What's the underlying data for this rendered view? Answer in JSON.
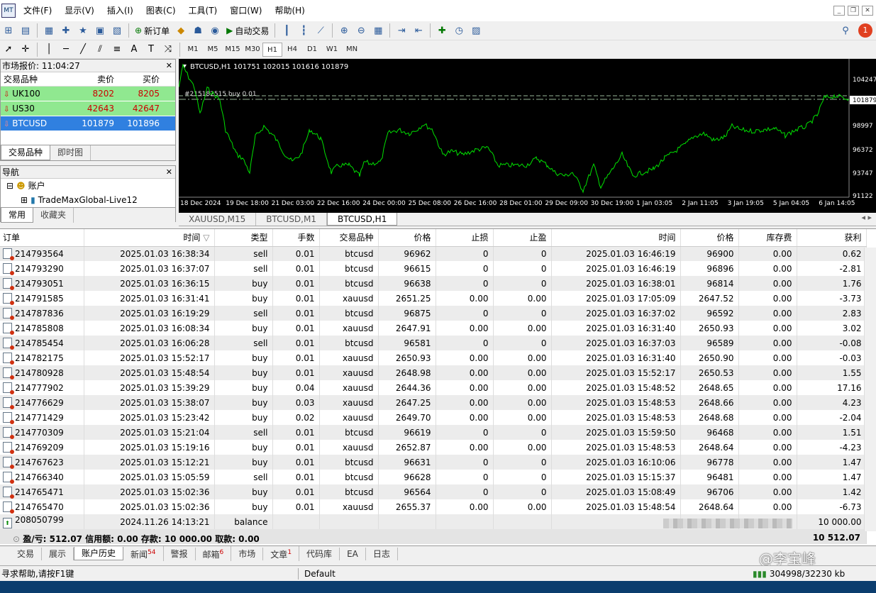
{
  "menu": {
    "items": [
      "文件(F)",
      "显示(V)",
      "插入(I)",
      "图表(C)",
      "工具(T)",
      "窗口(W)",
      "帮助(H)"
    ]
  },
  "toolbar": {
    "new_order": "新订单",
    "auto_trade": "自动交易",
    "timeframes": [
      "M1",
      "M5",
      "M15",
      "M30",
      "H1",
      "H4",
      "D1",
      "W1",
      "MN"
    ],
    "selected_tf": "H1",
    "alert_count": "1"
  },
  "market": {
    "title": "市场报价: 11:04:27",
    "col_symbol": "交易品种",
    "col_bid": "卖价",
    "col_ask": "买价",
    "rows": [
      {
        "symbol": "UK100",
        "bid": "8202",
        "ask": "8205"
      },
      {
        "symbol": "US30",
        "bid": "42643",
        "ask": "42647"
      },
      {
        "symbol": "BTCUSD",
        "bid": "101879",
        "ask": "101896"
      }
    ],
    "tabs": [
      "交易品种",
      "即时图"
    ]
  },
  "nav": {
    "title": "导航",
    "accounts": "账户",
    "account_name": "TradeMaxGlobal-Live12",
    "tabs": [
      "常用",
      "收藏夹"
    ]
  },
  "chart": {
    "header": "BTCUSD,H1  101751 102015 101616 101879",
    "order_label": "#215182515 buy 0.01",
    "price_labels": [
      "104247",
      "101879",
      "98997",
      "96372",
      "93747",
      "91122"
    ],
    "x_labels": [
      "18 Dec 2024",
      "19 Dec 18:00",
      "21 Dec 03:00",
      "22 Dec 16:00",
      "24 Dec 00:00",
      "25 Dec 08:00",
      "26 Dec 16:00",
      "28 Dec 01:00",
      "29 Dec 09:00",
      "30 Dec 19:00",
      "1 Jan 03:05",
      "2 Jan 11:05",
      "3 Jan 19:05",
      "5 Jan 04:05",
      "6 Jan 14:05"
    ],
    "colors": {
      "line": "#00e000",
      "bg": "#000000",
      "order_line": "#9ab89a"
    }
  },
  "chart_tabs": [
    "XAUUSD,M15",
    "BTCUSD,M1",
    "BTCUSD,H1"
  ],
  "history": {
    "headers": [
      "订单",
      "时间",
      "类型",
      "手数",
      "交易品种",
      "价格",
      "止损",
      "止盈",
      "时间",
      "价格",
      "库存费",
      "获利"
    ],
    "rows": [
      [
        "214793564",
        "2025.01.03 16:38:34",
        "sell",
        "0.01",
        "btcusd",
        "96962",
        "0",
        "0",
        "2025.01.03 16:46:19",
        "96900",
        "0.00",
        "0.62"
      ],
      [
        "214793290",
        "2025.01.03 16:37:07",
        "sell",
        "0.01",
        "btcusd",
        "96615",
        "0",
        "0",
        "2025.01.03 16:46:19",
        "96896",
        "0.00",
        "-2.81"
      ],
      [
        "214793051",
        "2025.01.03 16:36:15",
        "buy",
        "0.01",
        "btcusd",
        "96638",
        "0",
        "0",
        "2025.01.03 16:38:01",
        "96814",
        "0.00",
        "1.76"
      ],
      [
        "214791585",
        "2025.01.03 16:31:41",
        "buy",
        "0.01",
        "xauusd",
        "2651.25",
        "0.00",
        "0.00",
        "2025.01.03 17:05:09",
        "2647.52",
        "0.00",
        "-3.73"
      ],
      [
        "214787836",
        "2025.01.03 16:19:29",
        "sell",
        "0.01",
        "btcusd",
        "96875",
        "0",
        "0",
        "2025.01.03 16:37:02",
        "96592",
        "0.00",
        "2.83"
      ],
      [
        "214785808",
        "2025.01.03 16:08:34",
        "buy",
        "0.01",
        "xauusd",
        "2647.91",
        "0.00",
        "0.00",
        "2025.01.03 16:31:40",
        "2650.93",
        "0.00",
        "3.02"
      ],
      [
        "214785454",
        "2025.01.03 16:06:28",
        "sell",
        "0.01",
        "btcusd",
        "96581",
        "0",
        "0",
        "2025.01.03 16:37:03",
        "96589",
        "0.00",
        "-0.08"
      ],
      [
        "214782175",
        "2025.01.03 15:52:17",
        "buy",
        "0.01",
        "xauusd",
        "2650.93",
        "0.00",
        "0.00",
        "2025.01.03 16:31:40",
        "2650.90",
        "0.00",
        "-0.03"
      ],
      [
        "214780928",
        "2025.01.03 15:48:54",
        "buy",
        "0.01",
        "xauusd",
        "2648.98",
        "0.00",
        "0.00",
        "2025.01.03 15:52:17",
        "2650.53",
        "0.00",
        "1.55"
      ],
      [
        "214777902",
        "2025.01.03 15:39:29",
        "buy",
        "0.04",
        "xauusd",
        "2644.36",
        "0.00",
        "0.00",
        "2025.01.03 15:48:52",
        "2648.65",
        "0.00",
        "17.16"
      ],
      [
        "214776629",
        "2025.01.03 15:38:07",
        "buy",
        "0.03",
        "xauusd",
        "2647.25",
        "0.00",
        "0.00",
        "2025.01.03 15:48:53",
        "2648.66",
        "0.00",
        "4.23"
      ],
      [
        "214771429",
        "2025.01.03 15:23:42",
        "buy",
        "0.02",
        "xauusd",
        "2649.70",
        "0.00",
        "0.00",
        "2025.01.03 15:48:53",
        "2648.68",
        "0.00",
        "-2.04"
      ],
      [
        "214770309",
        "2025.01.03 15:21:04",
        "sell",
        "0.01",
        "btcusd",
        "96619",
        "0",
        "0",
        "2025.01.03 15:59:50",
        "96468",
        "0.00",
        "1.51"
      ],
      [
        "214769209",
        "2025.01.03 15:19:16",
        "buy",
        "0.01",
        "xauusd",
        "2652.87",
        "0.00",
        "0.00",
        "2025.01.03 15:48:53",
        "2648.64",
        "0.00",
        "-4.23"
      ],
      [
        "214767623",
        "2025.01.03 15:12:21",
        "buy",
        "0.01",
        "btcusd",
        "96631",
        "0",
        "0",
        "2025.01.03 16:10:06",
        "96778",
        "0.00",
        "1.47"
      ],
      [
        "214766340",
        "2025.01.03 15:05:59",
        "sell",
        "0.01",
        "btcusd",
        "96628",
        "0",
        "0",
        "2025.01.03 15:15:37",
        "96481",
        "0.00",
        "1.47"
      ],
      [
        "214765471",
        "2025.01.03 15:02:36",
        "buy",
        "0.01",
        "btcusd",
        "96564",
        "0",
        "0",
        "2025.01.03 15:08:49",
        "96706",
        "0.00",
        "1.42"
      ],
      [
        "214765470",
        "2025.01.03 15:02:36",
        "buy",
        "0.01",
        "xauusd",
        "2655.37",
        "0.00",
        "0.00",
        "2025.01.03 15:48:54",
        "2648.64",
        "0.00",
        "-6.73"
      ]
    ],
    "balance_row": {
      "order": "208050799",
      "time": "2024.11.26 14:13:21",
      "type": "balance",
      "profit": "10 000.00"
    },
    "summary": "盈/亏: 512.07  信用额: 0.00  存款: 10 000.00  取款: 0.00",
    "summary_total": "10 512.07"
  },
  "bottom_tabs": [
    {
      "label": "交易"
    },
    {
      "label": "展示"
    },
    {
      "label": "账户历史",
      "active": true
    },
    {
      "label": "新闻",
      "badge": "54"
    },
    {
      "label": "警报"
    },
    {
      "label": "邮箱",
      "badge": "6"
    },
    {
      "label": "市场"
    },
    {
      "label": "文章",
      "badge": "1"
    },
    {
      "label": "代码库"
    },
    {
      "label": "EA"
    },
    {
      "label": "日志"
    }
  ],
  "status": {
    "help": "寻求帮助,请按F1键",
    "profile": "Default",
    "traffic": "304998/32230 kb"
  },
  "watermark": "@李宝峰"
}
